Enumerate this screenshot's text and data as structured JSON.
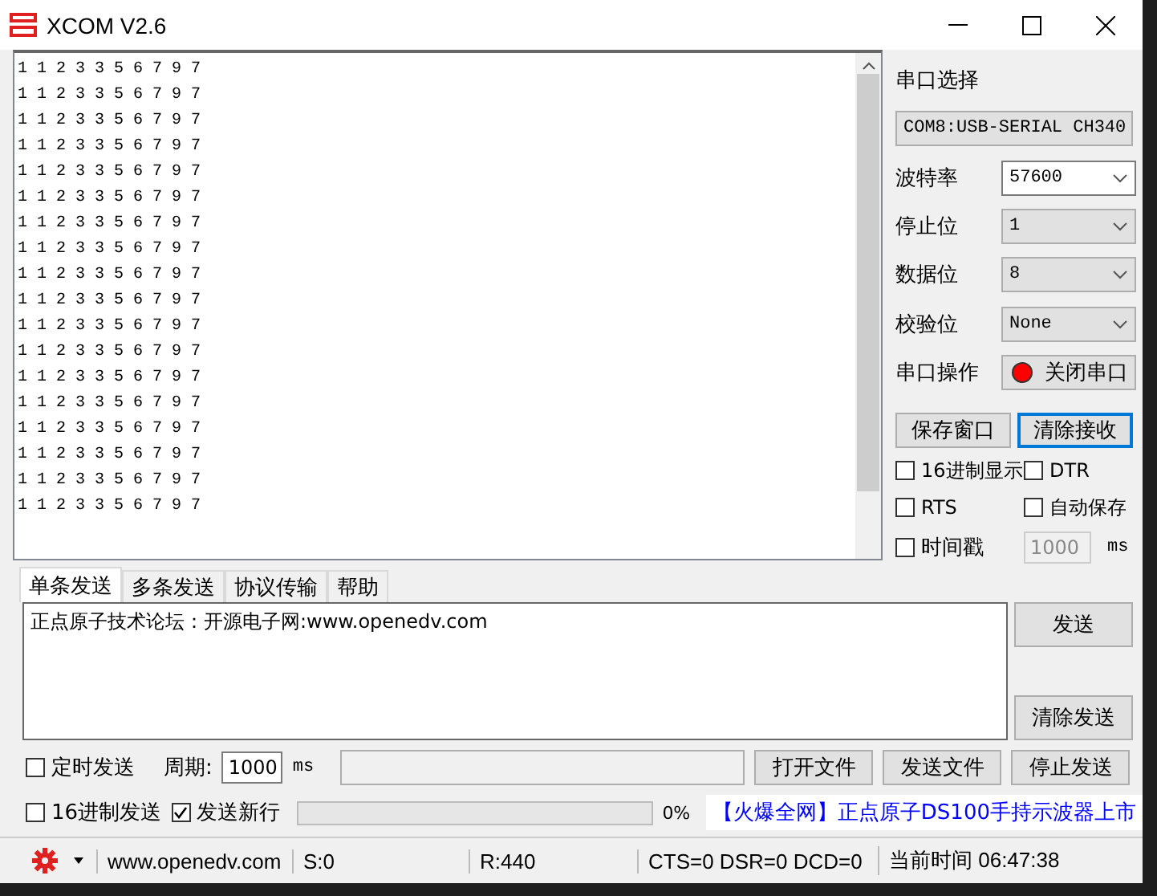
{
  "window": {
    "title": "XCOM V2.6"
  },
  "receive": {
    "lines": [
      "1 1 2 3 3 5 6 7 9 7",
      "1 1 2 3 3 5 6 7 9 7",
      "1 1 2 3 3 5 6 7 9 7",
      "1 1 2 3 3 5 6 7 9 7",
      "1 1 2 3 3 5 6 7 9 7",
      "1 1 2 3 3 5 6 7 9 7",
      "1 1 2 3 3 5 6 7 9 7",
      "1 1 2 3 3 5 6 7 9 7",
      "1 1 2 3 3 5 6 7 9 7",
      "1 1 2 3 3 5 6 7 9 7",
      "1 1 2 3 3 5 6 7 9 7",
      "1 1 2 3 3 5 6 7 9 7",
      "1 1 2 3 3 5 6 7 9 7",
      "1 1 2 3 3 5 6 7 9 7",
      "1 1 2 3 3 5 6 7 9 7",
      "1 1 2 3 3 5 6 7 9 7",
      "1 1 2 3 3 5 6 7 9 7",
      "1 1 2 3 3 5 6 7 9 7"
    ]
  },
  "port_select": {
    "label": "串口选择",
    "value": "COM8:USB-SERIAL CH340"
  },
  "settings": [
    {
      "label": "波特率",
      "value": "57600",
      "kind": "editable"
    },
    {
      "label": "停止位",
      "value": "1",
      "kind": "list"
    },
    {
      "label": "数据位",
      "value": "8",
      "kind": "list"
    },
    {
      "label": "校验位",
      "value": "None",
      "kind": "list"
    }
  ],
  "port_operation": {
    "label": "串口操作",
    "button": "关闭串口",
    "led_on": true
  },
  "receive_buttons": [
    {
      "label": "保存窗口",
      "focused": false
    },
    {
      "label": "清除接收",
      "focused": true
    }
  ],
  "options": [
    {
      "label": "16进制显示",
      "checked": false
    },
    {
      "label": "DTR",
      "checked": false
    },
    {
      "label": "RTS",
      "checked": false
    },
    {
      "label": "自动保存",
      "checked": false
    }
  ],
  "timestamp": {
    "label": "时间戳",
    "checked": false,
    "value": "1000",
    "unit": "ms"
  },
  "tabs": [
    {
      "label": "单条发送",
      "selected": true
    },
    {
      "label": "多条发送",
      "selected": false
    },
    {
      "label": "协议传输",
      "selected": false
    },
    {
      "label": "帮助",
      "selected": false
    }
  ],
  "send": {
    "text": "正点原子技术论坛：开源电子网:www.openedv.com",
    "buttons": [
      "发送",
      "清除发送"
    ]
  },
  "timed_send": {
    "label": "定时发送",
    "checked": false,
    "period_label": "周期:",
    "period": "1000",
    "unit": "ms"
  },
  "file_buttons": [
    "打开文件",
    "发送文件",
    "停止发送"
  ],
  "send_options": [
    {
      "label": "16进制发送",
      "checked": false
    },
    {
      "label": "发送新行",
      "checked": true
    }
  ],
  "progress": {
    "level": 0,
    "reading": "0%"
  },
  "ad": "【火爆全网】正点原子DS100手持示波器上市",
  "status_bar": [
    "www.openedv.com",
    "S:0",
    "R:440",
    "CTS=0 DSR=0 DCD=0",
    "当前时间 06:47:38"
  ]
}
